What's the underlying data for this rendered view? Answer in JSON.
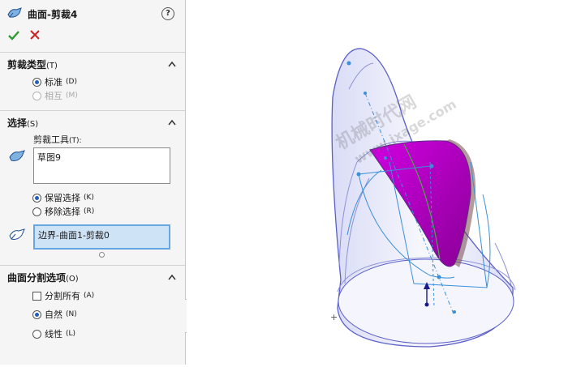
{
  "panel": {
    "title": "曲面-剪裁4",
    "help_glyph": "?",
    "ok_icon": "check-icon",
    "cancel_icon": "close-icon",
    "trim_type": {
      "title": "剪裁类型",
      "hotkey": "(T)",
      "options": [
        {
          "label": "标准",
          "hotkey": "(D)",
          "selected": true,
          "enabled": true
        },
        {
          "label": "相互",
          "hotkey": "(M)",
          "selected": false,
          "enabled": false
        }
      ]
    },
    "selections": {
      "title": "选择",
      "hotkey": "(S)",
      "trim_tool_label": "剪裁工具",
      "trim_tool_hotkey": "(T):",
      "trim_tool_value": "草图9",
      "keep_options": [
        {
          "label": "保留选择",
          "hotkey": "(K)",
          "selected": true
        },
        {
          "label": "移除选择",
          "hotkey": "(R)",
          "selected": false
        }
      ],
      "pieces_value": "边界-曲面1-剪裁0"
    },
    "split_options": {
      "title": "曲面分割选项",
      "hotkey": "(O)",
      "split_all_label": "分割所有",
      "split_all_hotkey": "(A)",
      "split_all_checked": false,
      "options": [
        {
          "label": "自然",
          "hotkey": "(N)",
          "selected": true
        },
        {
          "label": "线性",
          "hotkey": "(L)",
          "selected": false
        }
      ]
    }
  },
  "viewport": {
    "watermark_line1": "机械时代网",
    "watermark_line2": "www.jxage.com",
    "colors": {
      "surface_edge": "#5a5fc8",
      "trim_face": "#b000c8",
      "sketch_line": "#3a8fd8"
    }
  }
}
